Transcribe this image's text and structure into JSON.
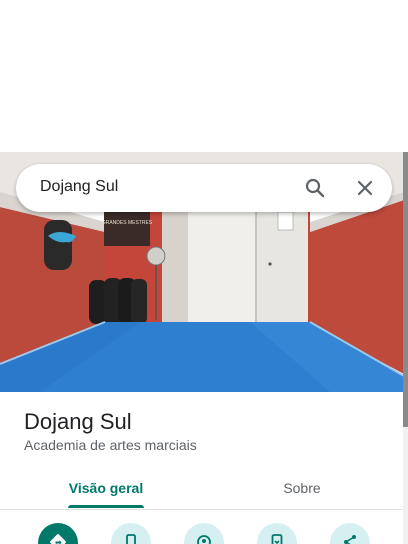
{
  "search": {
    "query": "Dojang Sul"
  },
  "place": {
    "title": "Dojang Sul",
    "category": "Academia de artes marciais"
  },
  "tabs": [
    {
      "label": "Visão geral",
      "selected": true
    },
    {
      "label": "Sobre",
      "selected": false
    }
  ],
  "photo": {
    "banner_text": "GRANDES MESTRES"
  },
  "actions": [
    {
      "icon": "directions-icon"
    },
    {
      "icon": "phone-icon"
    },
    {
      "icon": "save-icon"
    },
    {
      "icon": "send-to-phone-icon"
    },
    {
      "icon": "share-icon"
    }
  ],
  "colors": {
    "accent": "#00796b",
    "action_bg": "#d6f0f2",
    "text_primary": "#202124",
    "text_secondary": "#5f6368"
  }
}
